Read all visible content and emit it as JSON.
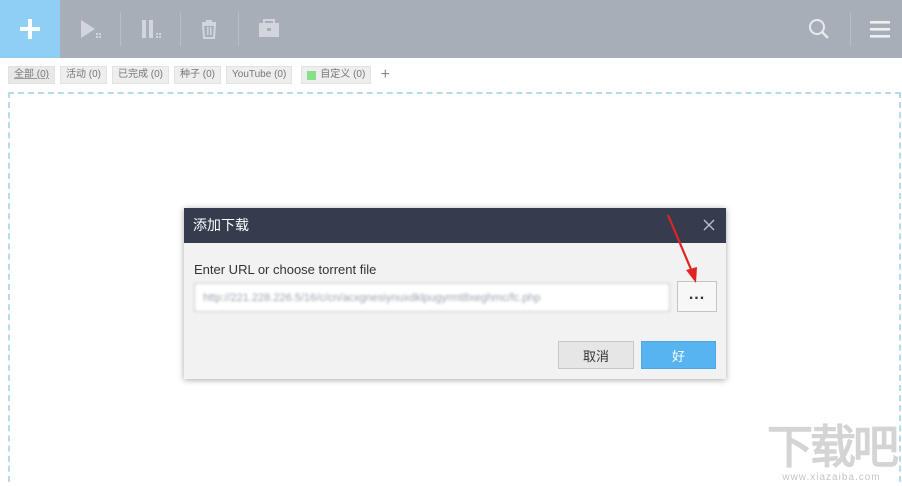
{
  "toolbar": {
    "add_icon": "plus-icon",
    "tools": [
      "play-all-icon",
      "pause-all-icon",
      "delete-icon",
      "folder-icon"
    ],
    "right_tools": [
      "search-icon",
      "menu-icon"
    ],
    "accent_color": "#8fcff5"
  },
  "tabs": [
    {
      "label": "全部 (0)"
    },
    {
      "label": "活动 (0)"
    },
    {
      "label": "已完成 (0)"
    },
    {
      "label": "种子 (0)"
    },
    {
      "label": "YouTube (0)"
    },
    {
      "label": "自定义 (0)",
      "dot_color": "#88df88"
    }
  ],
  "tab_add_label": "+",
  "dialog": {
    "title": "添加下载",
    "prompt": "Enter URL or choose torrent file",
    "url_value": "http://221.228.226.5/16/c/cn/acxgnesiynuxdklpugyrmt8xeghmc/fc.php",
    "browse_label": "...",
    "cancel_label": "取消",
    "ok_label": "好"
  },
  "watermark": {
    "logo": "下载吧",
    "site": "www.xiazaiba.com"
  }
}
